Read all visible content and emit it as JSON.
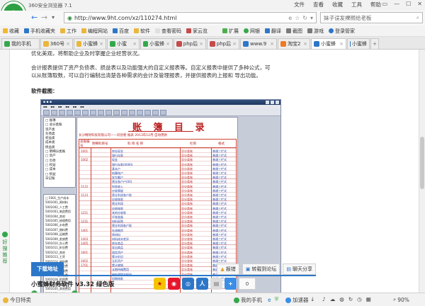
{
  "window": {
    "title": "360安全浏览器 7.1",
    "menus": [
      "文件",
      "查看",
      "收藏",
      "工具",
      "帮助"
    ],
    "controls": [
      "▭",
      "—",
      "☐",
      "✕"
    ]
  },
  "nav": {
    "back": "←",
    "forward": "→",
    "dropdown": "▾",
    "url": "http://www.9ht.com/xz/110274.html",
    "search_placeholder": "妹子误发裸照给老板"
  },
  "bookmarks": [
    "收藏",
    "手机收藏夹",
    "工作",
    "编程网站",
    "百度",
    "软件",
    "查看密码",
    "家云览",
    "扩展",
    "网银",
    "翻译",
    "截图",
    "游戏",
    "登录管家"
  ],
  "tabs": [
    {
      "label": "我的手机",
      "color": "#35a84a"
    },
    {
      "label": "360号",
      "color": "#e9b73a"
    },
    {
      "label": "小蜜蜂",
      "color": "#e9b73a"
    },
    {
      "label": "小蜜",
      "color": "#35a84a"
    },
    {
      "label": "小蜜蜂",
      "color": "#35a84a"
    },
    {
      "label": "php后",
      "color": "#c54b4b"
    },
    {
      "label": "php后",
      "color": "#c54b4b"
    },
    {
      "label": "www.9",
      "color": "#2d77c9"
    },
    {
      "label": "淘宝2",
      "color": "#ef7a22"
    },
    {
      "label": "小蜜蜂",
      "color": "#2d77c9"
    },
    {
      "label": "小蜜蜂",
      "color": "#2d77c9"
    }
  ],
  "article": {
    "line1": "优化美观，将帮助企业及时掌握企业经营状况。",
    "line2": "会计报表提供了资产负债表、损益表以及功能强大的自定义报表等。自定义报表中提供了多种公式，可",
    "line3": "以从账簿取数，可以自行编制出清楚各种需求的会计及管理报表，并提供报表的上报和  导出功能。",
    "section": "软件截图："
  },
  "screenshot": {
    "title": "账 簿 目 录",
    "subtitle": "长沙精财科技有限公司——同创者    报表    2013年12月  自动用款",
    "headers": [
      "总账编号",
      "明细科目号",
      "科 目 名 称",
      "",
      "栏目",
      "格式"
    ],
    "codes": [
      "1001",
      "",
      "1002",
      "",
      "",
      "",
      "",
      "",
      "1122",
      "",
      "1123",
      "",
      "",
      "",
      "1221",
      "",
      "1231",
      "",
      "1401",
      "",
      "1403",
      "1405",
      "",
      "1601",
      "",
      "1602",
      "1701",
      "",
      "",
      ""
    ],
    "names": [
      "库存现金",
      "银行存款",
      "现金",
      "银行存款(0000)",
      "基本户",
      "结算账户",
      "发生额户",
      "营业各户户(00)",
      "利息收入",
      "应收票据",
      "营业利润各户款",
      "应收账款",
      "营业利润",
      "应收账款",
      "其他应收款",
      "坏账准备",
      "材料采购",
      "营业利润各户款",
      "在途物资",
      "原材料",
      "材料成本差异",
      "库存商品",
      "发出商品",
      "固定资产",
      "累计折旧",
      "无形资产",
      "累计摊销",
      "长期待摊费用",
      "待处理财产损溢",
      "短期借款"
    ],
    "col3": [
      "总分类账",
      "总分类账",
      "总分类账",
      "总分类账",
      "总分类账",
      "总分类账",
      "总分类账",
      "总分类账",
      "总分类账",
      "总分类账",
      "总分类账",
      "总分类账",
      "总分类账",
      "总分类账",
      "总分类账",
      "总分类账",
      "总分类账",
      "总分类账",
      "总分类账",
      "总分类账",
      "总分类账",
      "总分类账",
      "总分类账",
      "总分类账",
      "总分类账",
      "总分类账",
      "总分类账",
      "总分类账",
      "总分类账",
      "总分类账"
    ],
    "col4": [
      "普通三栏式",
      "普通三栏式",
      "普通三栏式",
      "普通三栏式",
      "普通三栏式",
      "普通三栏式",
      "普通三栏式",
      "普通三栏式",
      "普通三栏式",
      "普通三栏式",
      "普通三栏式",
      "普通三栏式",
      "普通三栏式",
      "普通三栏式",
      "普通三栏式",
      "普通三栏式",
      "普通三栏式",
      "普通三栏式",
      "普通三栏式",
      "普通三栏式",
      "普通三栏式",
      "普通三栏式",
      "普通三栏式",
      "普通三栏式",
      "普通三栏式",
      "普通三栏式",
      "普通三栏式",
      "普通三栏式",
      "普通三栏式",
      "普通三栏式"
    ],
    "tree1": [
      "□ 账簿",
      "  □ 总分类账",
      "    资产类",
      "    负债类",
      "    权益类",
      "    成本类",
      "    损益类",
      "  □ 明细分类账",
      "    □ 资产",
      "    □ 负债",
      "    □ 权益",
      "    □ 成本",
      "    □ 损益",
      "  日记账"
    ],
    "tree2": [
      "□ 5001_生产成本",
      "  5001001_原材料",
      "  5001002_人工费",
      "  5001003_制造费用",
      "  5001004_其他",
      "  5001005_修理费用",
      "  5001006_水电费",
      "  5001007_燃料费",
      "  5001008_运输费",
      "  5001009_差旅费",
      "  5001010_办公费",
      "  5001011_折旧费",
      "  5001012_其他",
      "  5001013_工资",
      "  5001014_福利费",
      "  5001015_保险费",
      "  5001016_劳保费",
      "  5001017_研发费",
      "  5001018_租赁费",
      "  5001019_维修费",
      "  5001020_其他费用",
      "  5001021_材料",
      "  5001022_设备"
    ]
  },
  "download": {
    "label": "下载地址",
    "actions": [
      "报错",
      "转载到论坛",
      "聊天分享"
    ],
    "software": "小蜜蜂财务软件 v3.32 绿色版",
    "share_count": "0"
  },
  "sidebar": {
    "recommend": "好搜推荐"
  },
  "status": {
    "left": "今日特卖",
    "phone": "我的手机",
    "accel": "加速器",
    "dl": "↓",
    "zoom": "90%"
  }
}
